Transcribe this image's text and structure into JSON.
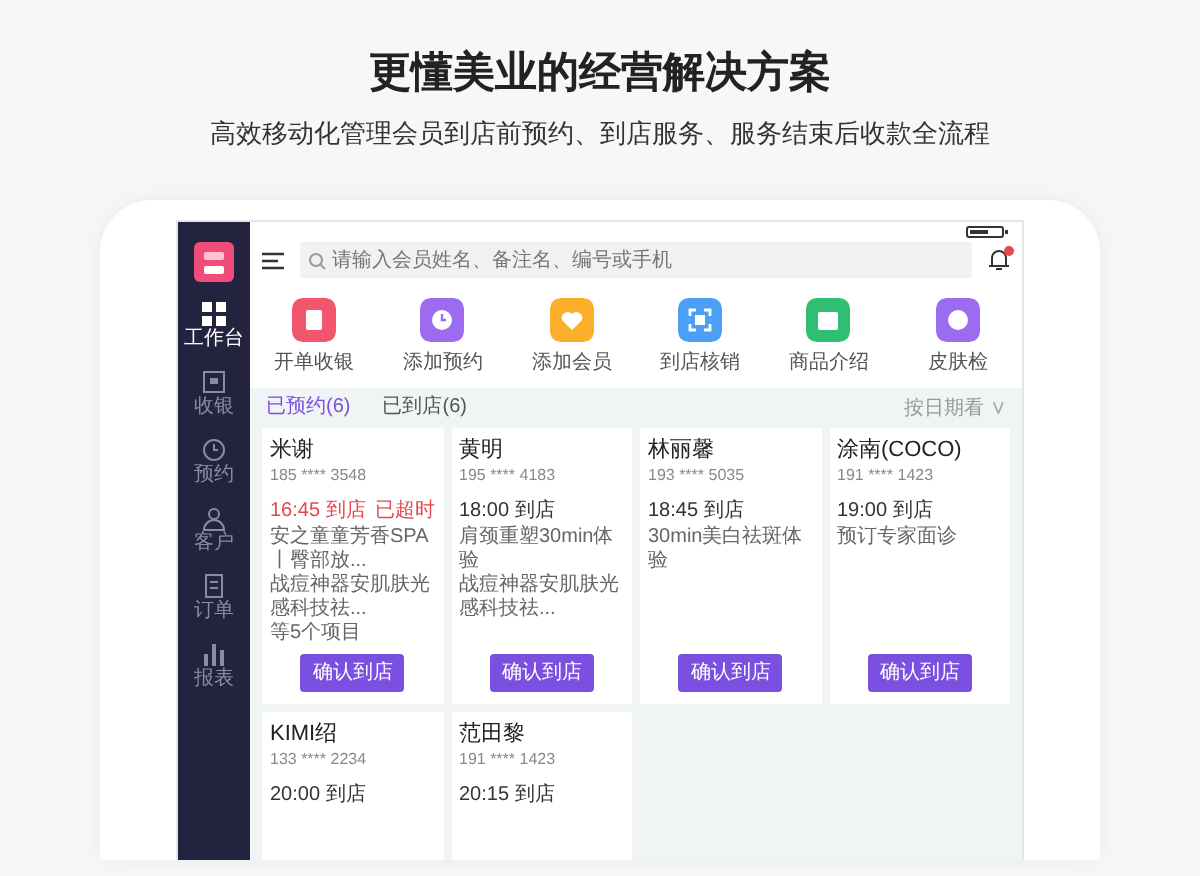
{
  "hero": {
    "title": "更懂美业的经营解决方案",
    "subtitle": "高效移动化管理会员到店前预约、到店服务、服务结束后收款全流程"
  },
  "sidebar": {
    "items": [
      {
        "label": "工作台",
        "kind": "grid",
        "selected": true
      },
      {
        "label": "收银",
        "kind": "register",
        "selected": false
      },
      {
        "label": "预约",
        "kind": "clock",
        "selected": false
      },
      {
        "label": "客户",
        "kind": "person",
        "selected": false
      },
      {
        "label": "订单",
        "kind": "doc",
        "selected": false
      },
      {
        "label": "报表",
        "kind": "bars",
        "selected": false
      }
    ]
  },
  "search": {
    "placeholder": "请输入会员姓名、备注名、编号或手机"
  },
  "notifications": {
    "badge": true
  },
  "actions": [
    {
      "label": "开单收银",
      "kind": "note",
      "color": "#f2566c"
    },
    {
      "label": "添加预约",
      "kind": "clock",
      "color": "#9b6cf0"
    },
    {
      "label": "添加会员",
      "kind": "heart",
      "color": "#fbae2a"
    },
    {
      "label": "到店核销",
      "kind": "scan",
      "color": "#4b9ff5"
    },
    {
      "label": "商品介绍",
      "kind": "bag",
      "color": "#2fbf72"
    },
    {
      "label": "皮肤检",
      "kind": "face",
      "color": "#9b6cf0"
    }
  ],
  "tabs": [
    {
      "label": "已预约(6)",
      "selected": true
    },
    {
      "label": "已到店(6)",
      "selected": false
    }
  ],
  "sort": {
    "label": "按日期看 ∨"
  },
  "cards": [
    {
      "name": "米谢",
      "phone": "185 **** 3548",
      "time": "16:45 到店",
      "overdue": true,
      "status": "已超时",
      "items": [
        "安之童童芳香SPA丨臀部放...",
        "战痘神器安肌肤光感科技祛...",
        "等5个项目"
      ],
      "button": "确认到店"
    },
    {
      "name": "黄明",
      "phone": "195 **** 4183",
      "time": "18:00 到店",
      "overdue": false,
      "items": [
        "肩颈重塑30min体验",
        "战痘神器安肌肤光感科技祛..."
      ],
      "button": "确认到店"
    },
    {
      "name": "林丽馨",
      "phone": "193 **** 5035",
      "time": "18:45 到店",
      "overdue": false,
      "items": [
        "30min美白祛斑体验"
      ],
      "button": "确认到店"
    },
    {
      "name": "涂南(COCO)",
      "phone": "191 **** 1423",
      "time": "19:00 到店",
      "overdue": false,
      "items": [
        "预订专家面诊"
      ],
      "button": "确认到店"
    },
    {
      "name": "KIMI绍",
      "phone": "133 **** 2234",
      "time": "20:00 到店",
      "overdue": false
    },
    {
      "name": "范田黎",
      "phone": "191 **** 1423",
      "time": "20:15 到店",
      "overdue": false
    }
  ]
}
